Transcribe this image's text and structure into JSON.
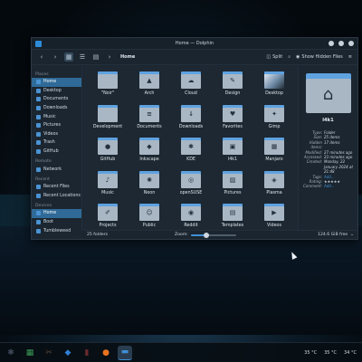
{
  "window": {
    "title": "Home — Dolphin",
    "toolbar": {
      "breadcrumb": "Home",
      "split_label": "Split",
      "hidden_files_label": "Show Hidden Files"
    }
  },
  "sidebar": {
    "sections": [
      {
        "title": "Places",
        "items": [
          {
            "label": "Home",
            "selected": true
          },
          {
            "label": "Desktop"
          },
          {
            "label": "Documents"
          },
          {
            "label": "Downloads"
          },
          {
            "label": "Music"
          },
          {
            "label": "Pictures"
          },
          {
            "label": "Videos"
          },
          {
            "label": "Trash"
          },
          {
            "label": "GitHub"
          }
        ]
      },
      {
        "title": "Remote",
        "items": [
          {
            "label": "Network"
          }
        ]
      },
      {
        "title": "Recent",
        "items": [
          {
            "label": "Recent Files"
          },
          {
            "label": "Recent Locations"
          }
        ]
      },
      {
        "title": "Devices",
        "items": [
          {
            "label": "Home",
            "selected": true
          },
          {
            "label": "Boot"
          },
          {
            "label": "Tumbleweed"
          }
        ]
      }
    ]
  },
  "files": [
    {
      "label": "\"Noir\"",
      "icon": "folder",
      "glyph": ""
    },
    {
      "label": "Arch",
      "icon": "arch-folder-icon",
      "glyph": "▲"
    },
    {
      "label": "Cloud",
      "icon": "cloud-folder-icon",
      "glyph": "☁"
    },
    {
      "label": "Design",
      "icon": "design-folder-icon",
      "glyph": "✎"
    },
    {
      "label": "Desktop",
      "icon": "desktop-folder-icon",
      "glyph": "",
      "thumb": true
    },
    {
      "label": "Development",
      "icon": "development-folder-icon",
      "glyph": ""
    },
    {
      "label": "Documents",
      "icon": "documents-folder-icon",
      "glyph": "≡"
    },
    {
      "label": "Downloads",
      "icon": "downloads-folder-icon",
      "glyph": "↓"
    },
    {
      "label": "Favorites",
      "icon": "favorites-folder-icon",
      "glyph": "♥"
    },
    {
      "label": "Gimp",
      "icon": "gimp-folder-icon",
      "glyph": "✦"
    },
    {
      "label": "GitHub",
      "icon": "github-folder-icon",
      "glyph": "●"
    },
    {
      "label": "Inkscape",
      "icon": "inkscape-folder-icon",
      "glyph": "◆"
    },
    {
      "label": "KDE",
      "icon": "kde-folder-icon",
      "glyph": "✱"
    },
    {
      "label": "l4k1",
      "icon": "l4k1-folder-icon",
      "glyph": "▣"
    },
    {
      "label": "Manjaro",
      "icon": "manjaro-folder-icon",
      "glyph": "▦"
    },
    {
      "label": "Music",
      "icon": "music-folder-icon",
      "glyph": "♪"
    },
    {
      "label": "Neon",
      "icon": "neon-folder-icon",
      "glyph": "✺"
    },
    {
      "label": "openSUSE",
      "icon": "opensuse-folder-icon",
      "glyph": "◎"
    },
    {
      "label": "Pictures",
      "icon": "pictures-folder-icon",
      "glyph": "▨"
    },
    {
      "label": "Plasma",
      "icon": "plasma-folder-icon",
      "glyph": "◈"
    },
    {
      "label": "Projects",
      "icon": "projects-folder-icon",
      "glyph": "✐"
    },
    {
      "label": "Public",
      "icon": "public-folder-icon",
      "glyph": "☺"
    },
    {
      "label": "Reddit",
      "icon": "reddit-folder-icon",
      "glyph": "◉"
    },
    {
      "label": "Templates",
      "icon": "templates-folder-icon",
      "glyph": "▤"
    },
    {
      "label": "Videos",
      "icon": "videos-folder-icon",
      "glyph": "▶"
    }
  ],
  "statusbar": {
    "count": "25 folders",
    "zoom_label": "Zoom:",
    "zoom_level": 0.35,
    "free_space": "124.6 GiB free"
  },
  "info_panel": {
    "name": "l4k1",
    "rows": [
      {
        "key": "Type:",
        "value": "Folder"
      },
      {
        "key": "Size:",
        "value": "25 items"
      },
      {
        "key": "Hidden items:",
        "value": "17 items"
      },
      {
        "key": "Modified:",
        "value": "27 minutes ago"
      },
      {
        "key": "Accessed:",
        "value": "23 minutes ago"
      },
      {
        "key": "Created:",
        "value": "Monday, 22 January 2024 at 21:48"
      },
      {
        "key": "Tags:",
        "value": "Add...",
        "link": true
      },
      {
        "key": "Rating:",
        "value": "★★★★★"
      },
      {
        "key": "Comment:",
        "value": "Add...",
        "link": true
      }
    ]
  },
  "taskbar": {
    "apps": [
      {
        "name": "app-launcher-icon",
        "glyph": "✱",
        "color": "#3c4a58"
      },
      {
        "name": "system-monitor-icon",
        "glyph": "▦",
        "color": "#3a9a56"
      },
      {
        "name": "tools-icon",
        "glyph": "✂",
        "color": "#5a4a3a"
      },
      {
        "name": "app-store-icon",
        "glyph": "◆",
        "color": "#2f7fd3"
      },
      {
        "name": "terminal-icon",
        "glyph": "▮",
        "color": "#6a2a2a"
      },
      {
        "name": "firefox-icon",
        "glyph": "●",
        "color": "#e8741f"
      },
      {
        "name": "dolphin-icon",
        "glyph": "▬",
        "color": "#3f8fd6",
        "active": true
      }
    ],
    "temps": [
      "35 °C",
      "35 °C",
      "34 °C"
    ]
  },
  "colors": {
    "accent": "#3f8fd6",
    "folder_tab": "#5ea2e0",
    "folder_body": "#a9b7c4",
    "window_bg": "#1b2630"
  }
}
